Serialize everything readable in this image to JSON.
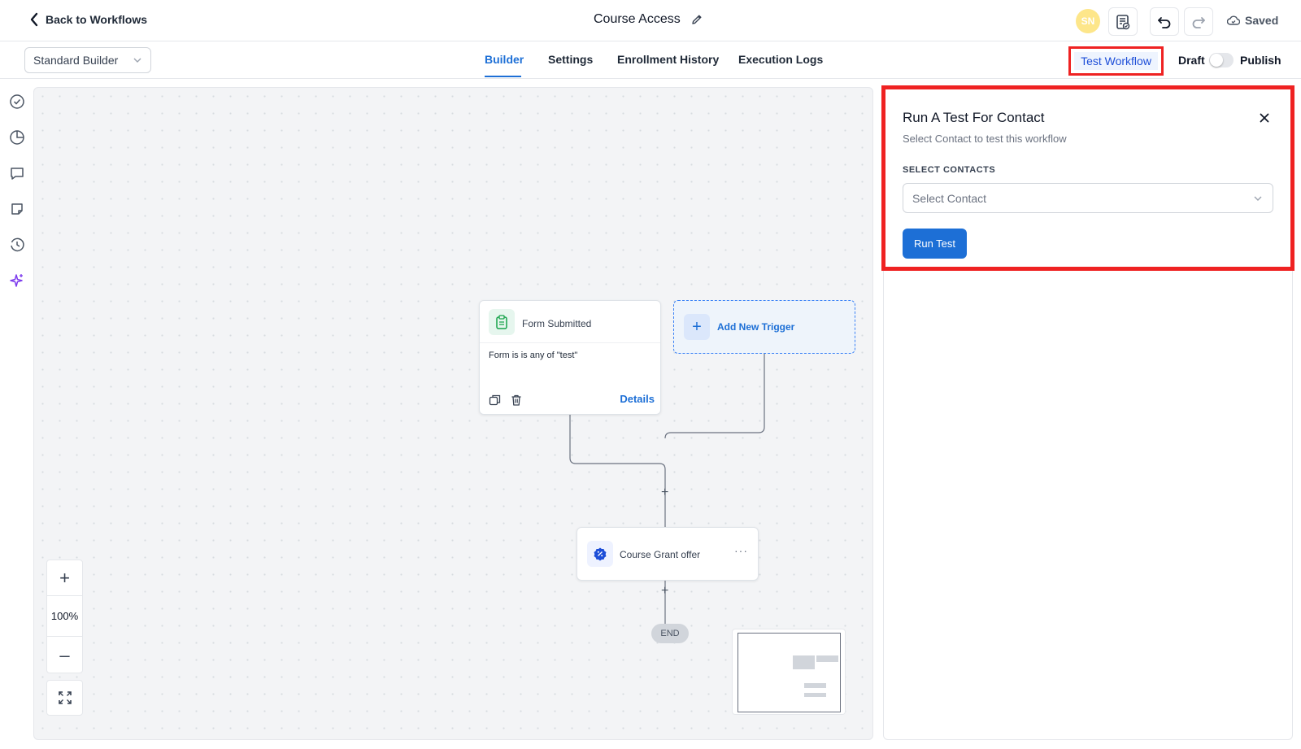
{
  "header": {
    "back_label": "Back to Workflows",
    "workflow_title": "Course Access",
    "avatar_initials": "SN",
    "saved_label": "Saved"
  },
  "subbar": {
    "builder_mode": "Standard Builder",
    "tabs": [
      {
        "label": "Builder",
        "active": true
      },
      {
        "label": "Settings",
        "active": false
      },
      {
        "label": "Enrollment History",
        "active": false
      },
      {
        "label": "Execution Logs",
        "active": false
      }
    ],
    "test_workflow_label": "Test Workflow",
    "draft_label": "Draft",
    "publish_label": "Publish",
    "publish_toggle_on": false
  },
  "canvas": {
    "trigger_node": {
      "name": "Form Submitted",
      "condition": "Form is is any of \"test\"",
      "details_label": "Details"
    },
    "add_trigger_label": "Add New Trigger",
    "action_node": {
      "name": "Course Grant offer",
      "more": "···"
    },
    "end_label": "END",
    "zoom": {
      "in_symbol": "+",
      "level": "100%",
      "out_symbol": "–"
    },
    "plus_symbol": "+"
  },
  "test_panel": {
    "title": "Run A Test For Contact",
    "subtitle": "Select Contact to test this workflow",
    "select_label": "SELECT CONTACTS",
    "select_placeholder": "Select Contact",
    "run_label": "Run Test"
  },
  "colors": {
    "accent": "#1d6fd6",
    "highlight": "#ef2222",
    "canvas_bg": "#f3f4f6"
  }
}
